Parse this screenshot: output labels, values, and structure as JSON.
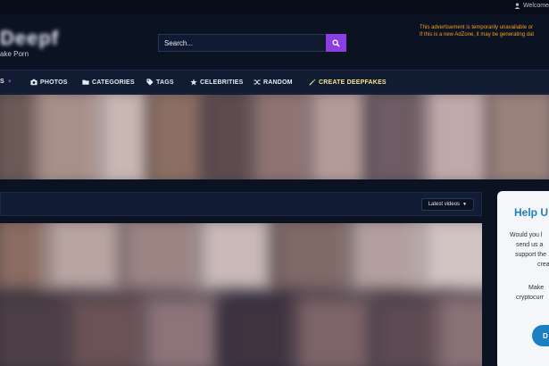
{
  "topbar": {
    "welcome": "Welcome"
  },
  "header": {
    "logo": "Deepf",
    "tagline": "ake Porn",
    "search_placeholder": "Search...",
    "ad_notice_line1": "This advertisement is temporarily unavailable or",
    "ad_notice_line2": "If this is a new AdZone, it may be generating dat"
  },
  "nav": {
    "items": [
      {
        "label": "S",
        "icon": "caret-icon"
      },
      {
        "label": "PHOTOS",
        "icon": "camera-icon"
      },
      {
        "label": "CATEGORIES",
        "icon": "folder-icon"
      },
      {
        "label": "TAGS",
        "icon": "tag-icon"
      },
      {
        "label": "CELEBRITIES",
        "icon": "star-icon"
      },
      {
        "label": "RANDOM",
        "icon": "shuffle-icon"
      },
      {
        "label": "CREATE DEEPFAKES",
        "icon": "wand-icon"
      }
    ]
  },
  "section": {
    "sort_label": "Latest videos"
  },
  "help": {
    "title": "Help U",
    "lines": [
      "Would you l",
      "send us a",
      "support the",
      "crea",
      "Make",
      "cryptocurr"
    ],
    "button": "D"
  },
  "colors": {
    "accent": "#8b3fe0",
    "highlight": "#f6e58d",
    "ad_text": "#f0a020",
    "help_blue": "#1f7fc0"
  }
}
